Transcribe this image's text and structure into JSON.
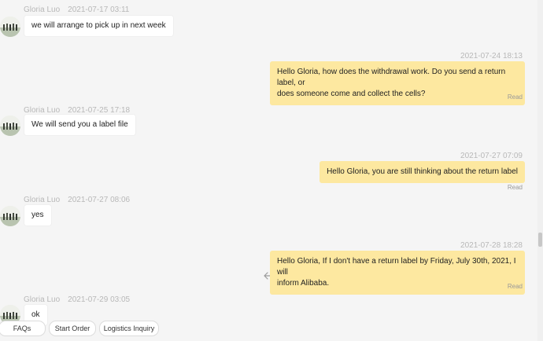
{
  "messages": [
    {
      "sender": "Gloria Luo",
      "time": "2021-07-17 03:11",
      "text": "we will arrange to pick up in next week"
    },
    {
      "time": "2021-07-24 18:13",
      "line1": "Hello Gloria, how does the withdrawal work. Do you send a return label, or",
      "line2": "does someone come and collect the cells?",
      "status": "Read"
    },
    {
      "sender": "Gloria Luo",
      "time": "2021-07-25 17:18",
      "text": "We will send you a label file"
    },
    {
      "time": "2021-07-27 07:09",
      "text": "Hello Gloria, you are still thinking about the return label",
      "status": "Read"
    },
    {
      "sender": "Gloria Luo",
      "time": "2021-07-27 08:06",
      "text": "yes"
    },
    {
      "time": "2021-07-28 18:28",
      "line1": "Hello Gloria, If I don't have a return label by Friday, July 30th, 2021, I will",
      "line2": "inform Alibaba.",
      "status": "Read"
    },
    {
      "sender": "Gloria Luo",
      "time": "2021-07-29 03:05",
      "text": "ok"
    }
  ],
  "quick_actions": [
    "FAQs",
    "Start Order",
    "Logistics Inquiry"
  ],
  "colors": {
    "outgoing_bubble": "#fde8a0",
    "incoming_bubble": "#ffffff",
    "background": "#f5f5f5"
  },
  "icons": {
    "avatar": "avatar",
    "resend": "reply-arrow-icon"
  }
}
